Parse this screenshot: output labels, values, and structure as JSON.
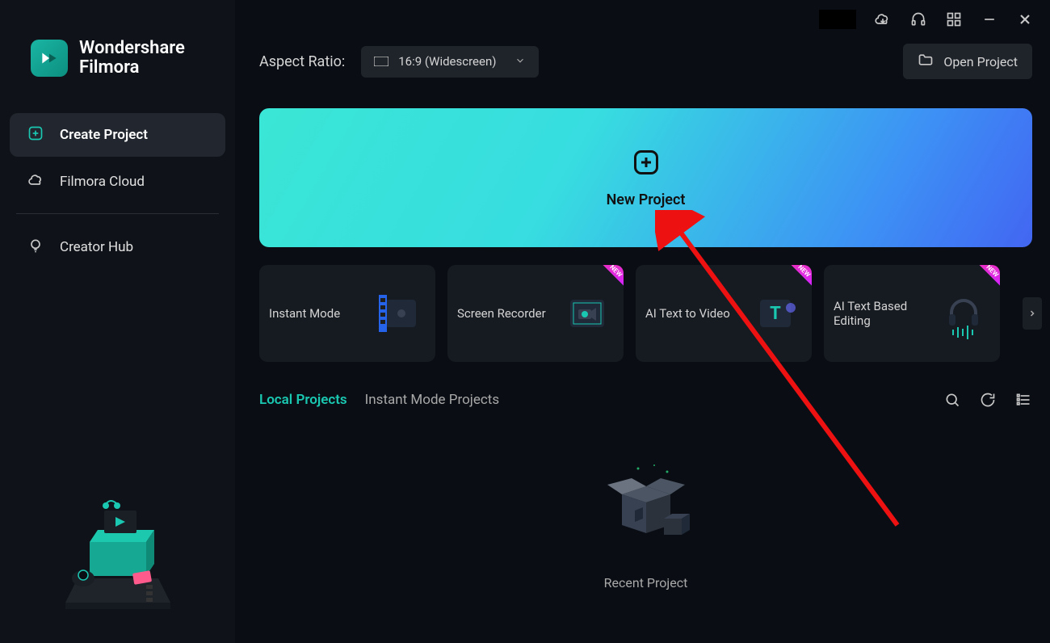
{
  "brand": {
    "line1": "Wondershare",
    "line2": "Filmora"
  },
  "sidebar": {
    "items": [
      {
        "label": "Create Project"
      },
      {
        "label": "Filmora Cloud"
      },
      {
        "label": "Creator Hub"
      }
    ]
  },
  "top": {
    "aspect_label": "Aspect Ratio:",
    "aspect_value": "16:9 (Widescreen)",
    "open_project": "Open Project"
  },
  "banner": {
    "label": "New Project"
  },
  "modes": [
    {
      "label": "Instant Mode",
      "new": false,
      "icon": "film"
    },
    {
      "label": "Screen Recorder",
      "new": true,
      "icon": "camera"
    },
    {
      "label": "AI Text to Video",
      "new": true,
      "icon": "text"
    },
    {
      "label": "AI Text Based Editing",
      "new": true,
      "icon": "audio"
    }
  ],
  "new_badge_text": "NEW",
  "tabs": [
    {
      "label": "Local Projects",
      "active": true
    },
    {
      "label": "Instant Mode Projects",
      "active": false
    }
  ],
  "recent": {
    "label": "Recent Project"
  }
}
